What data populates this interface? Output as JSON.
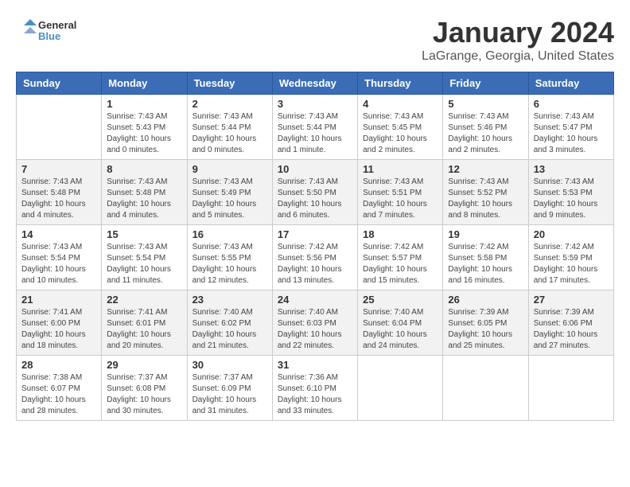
{
  "header": {
    "logo_line1": "General",
    "logo_line2": "Blue",
    "title": "January 2024",
    "subtitle": "LaGrange, Georgia, United States"
  },
  "days_of_week": [
    "Sunday",
    "Monday",
    "Tuesday",
    "Wednesday",
    "Thursday",
    "Friday",
    "Saturday"
  ],
  "weeks": [
    [
      {
        "day": "",
        "info": ""
      },
      {
        "day": "1",
        "info": "Sunrise: 7:43 AM\nSunset: 5:43 PM\nDaylight: 10 hours\nand 0 minutes."
      },
      {
        "day": "2",
        "info": "Sunrise: 7:43 AM\nSunset: 5:44 PM\nDaylight: 10 hours\nand 0 minutes."
      },
      {
        "day": "3",
        "info": "Sunrise: 7:43 AM\nSunset: 5:44 PM\nDaylight: 10 hours\nand 1 minute."
      },
      {
        "day": "4",
        "info": "Sunrise: 7:43 AM\nSunset: 5:45 PM\nDaylight: 10 hours\nand 2 minutes."
      },
      {
        "day": "5",
        "info": "Sunrise: 7:43 AM\nSunset: 5:46 PM\nDaylight: 10 hours\nand 2 minutes."
      },
      {
        "day": "6",
        "info": "Sunrise: 7:43 AM\nSunset: 5:47 PM\nDaylight: 10 hours\nand 3 minutes."
      }
    ],
    [
      {
        "day": "7",
        "info": "Sunrise: 7:43 AM\nSunset: 5:48 PM\nDaylight: 10 hours\nand 4 minutes."
      },
      {
        "day": "8",
        "info": "Sunrise: 7:43 AM\nSunset: 5:48 PM\nDaylight: 10 hours\nand 4 minutes."
      },
      {
        "day": "9",
        "info": "Sunrise: 7:43 AM\nSunset: 5:49 PM\nDaylight: 10 hours\nand 5 minutes."
      },
      {
        "day": "10",
        "info": "Sunrise: 7:43 AM\nSunset: 5:50 PM\nDaylight: 10 hours\nand 6 minutes."
      },
      {
        "day": "11",
        "info": "Sunrise: 7:43 AM\nSunset: 5:51 PM\nDaylight: 10 hours\nand 7 minutes."
      },
      {
        "day": "12",
        "info": "Sunrise: 7:43 AM\nSunset: 5:52 PM\nDaylight: 10 hours\nand 8 minutes."
      },
      {
        "day": "13",
        "info": "Sunrise: 7:43 AM\nSunset: 5:53 PM\nDaylight: 10 hours\nand 9 minutes."
      }
    ],
    [
      {
        "day": "14",
        "info": "Sunrise: 7:43 AM\nSunset: 5:54 PM\nDaylight: 10 hours\nand 10 minutes."
      },
      {
        "day": "15",
        "info": "Sunrise: 7:43 AM\nSunset: 5:54 PM\nDaylight: 10 hours\nand 11 minutes."
      },
      {
        "day": "16",
        "info": "Sunrise: 7:43 AM\nSunset: 5:55 PM\nDaylight: 10 hours\nand 12 minutes."
      },
      {
        "day": "17",
        "info": "Sunrise: 7:42 AM\nSunset: 5:56 PM\nDaylight: 10 hours\nand 13 minutes."
      },
      {
        "day": "18",
        "info": "Sunrise: 7:42 AM\nSunset: 5:57 PM\nDaylight: 10 hours\nand 15 minutes."
      },
      {
        "day": "19",
        "info": "Sunrise: 7:42 AM\nSunset: 5:58 PM\nDaylight: 10 hours\nand 16 minutes."
      },
      {
        "day": "20",
        "info": "Sunrise: 7:42 AM\nSunset: 5:59 PM\nDaylight: 10 hours\nand 17 minutes."
      }
    ],
    [
      {
        "day": "21",
        "info": "Sunrise: 7:41 AM\nSunset: 6:00 PM\nDaylight: 10 hours\nand 18 minutes."
      },
      {
        "day": "22",
        "info": "Sunrise: 7:41 AM\nSunset: 6:01 PM\nDaylight: 10 hours\nand 20 minutes."
      },
      {
        "day": "23",
        "info": "Sunrise: 7:40 AM\nSunset: 6:02 PM\nDaylight: 10 hours\nand 21 minutes."
      },
      {
        "day": "24",
        "info": "Sunrise: 7:40 AM\nSunset: 6:03 PM\nDaylight: 10 hours\nand 22 minutes."
      },
      {
        "day": "25",
        "info": "Sunrise: 7:40 AM\nSunset: 6:04 PM\nDaylight: 10 hours\nand 24 minutes."
      },
      {
        "day": "26",
        "info": "Sunrise: 7:39 AM\nSunset: 6:05 PM\nDaylight: 10 hours\nand 25 minutes."
      },
      {
        "day": "27",
        "info": "Sunrise: 7:39 AM\nSunset: 6:06 PM\nDaylight: 10 hours\nand 27 minutes."
      }
    ],
    [
      {
        "day": "28",
        "info": "Sunrise: 7:38 AM\nSunset: 6:07 PM\nDaylight: 10 hours\nand 28 minutes."
      },
      {
        "day": "29",
        "info": "Sunrise: 7:37 AM\nSunset: 6:08 PM\nDaylight: 10 hours\nand 30 minutes."
      },
      {
        "day": "30",
        "info": "Sunrise: 7:37 AM\nSunset: 6:09 PM\nDaylight: 10 hours\nand 31 minutes."
      },
      {
        "day": "31",
        "info": "Sunrise: 7:36 AM\nSunset: 6:10 PM\nDaylight: 10 hours\nand 33 minutes."
      },
      {
        "day": "",
        "info": ""
      },
      {
        "day": "",
        "info": ""
      },
      {
        "day": "",
        "info": ""
      }
    ]
  ]
}
